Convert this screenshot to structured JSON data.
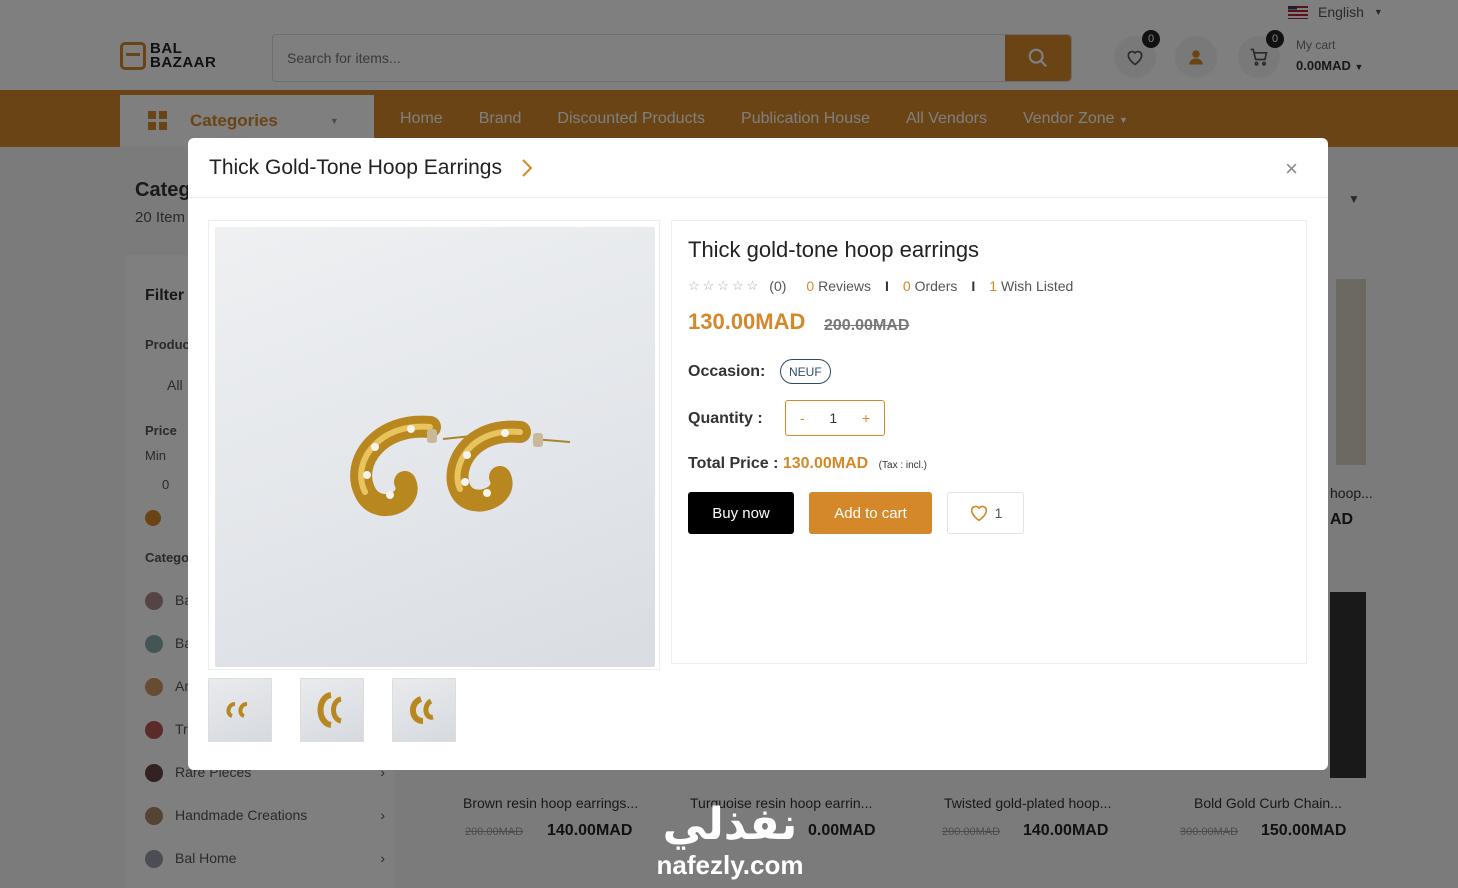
{
  "header": {
    "language": "English",
    "logo_line1": "BAL",
    "logo_line2": "BAZAAR",
    "search_placeholder": "Search for items...",
    "wishlist_count": "0",
    "cart_count": "0",
    "cart_label": "My cart",
    "cart_amount": "0.00MAD"
  },
  "nav": {
    "categories_label": "Categories",
    "links": [
      "Home",
      "Brand",
      "Discounted Products",
      "Publication House",
      "All Vendors",
      "Vendor Zone"
    ]
  },
  "background": {
    "page_title": "Categ",
    "item_count": "20 Item",
    "filter_label": "Filter",
    "product_label": "Produc",
    "all_label": "All",
    "price_label": "Price",
    "min_label": "Min",
    "min_value": "0",
    "category_label": "Catego",
    "side_categories": [
      "Ba",
      "Ba",
      "Ar",
      "Tr",
      "Rare Pieces",
      "Handmade Creations",
      "Bal Home"
    ],
    "products": [
      {
        "name": "Brown resin hoop earrings...",
        "old": "200.00MAD",
        "price": "140.00MAD"
      },
      {
        "name": "Turquoise resin hoop earrin...",
        "old": "",
        "price": "0.00MAD"
      },
      {
        "name": "Twisted gold-plated hoop...",
        "old": "200.00MAD",
        "price": "140.00MAD"
      },
      {
        "name": "Bold Gold Curb Chain...",
        "old": "300.00MAD",
        "price": "150.00MAD"
      }
    ],
    "right_partial_name": "hoop...",
    "right_partial_price": "AD"
  },
  "modal": {
    "header_title": "Thick Gold-Tone Hoop Earrings",
    "close_symbol": "×",
    "product_title": "Thick gold-tone hoop earrings",
    "rating_count": "(0)",
    "reviews_num": "0",
    "reviews_label": "Reviews",
    "orders_num": "0",
    "orders_label": "Orders",
    "wish_num": "1",
    "wish_label": "Wish Listed",
    "price": "130.00MAD",
    "old_price": "200.00MAD",
    "occasion_label": "Occasion:",
    "occasion_value": "NEUF",
    "quantity_label": "Quantity :",
    "qty_minus": "-",
    "qty_value": "1",
    "qty_plus": "+",
    "total_label": "Total Price :",
    "total_value": "130.00MAD",
    "tax_note": "(Tax : incl.)",
    "buy_now": "Buy now",
    "add_to_cart": "Add to cart",
    "wishlist_count": "1"
  },
  "watermark": {
    "arabic": "نفذلي",
    "latin": "nafezly.com"
  },
  "colors": {
    "accent": "#d4882a",
    "dark": "#000000",
    "overlay": "rgba(0,0,0,0.5)"
  }
}
